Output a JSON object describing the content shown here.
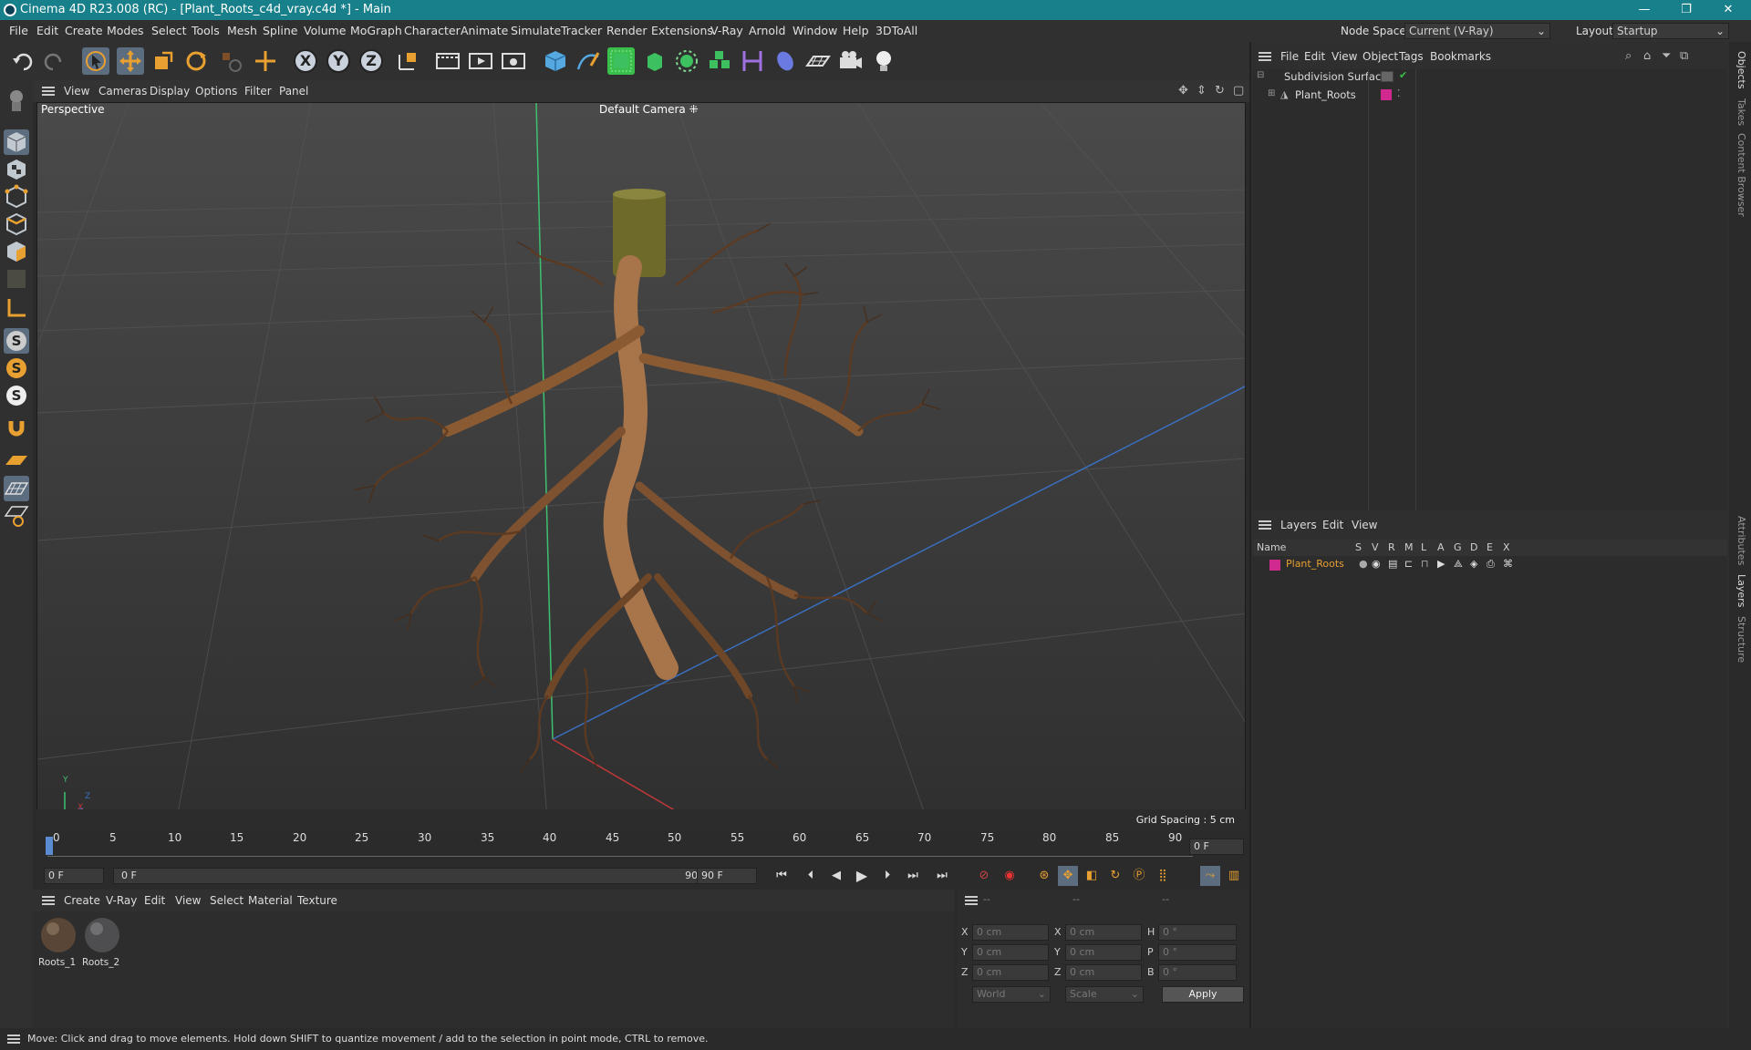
{
  "window": {
    "title": "Cinema 4D R23.008 (RC) - [Plant_Roots_c4d_vray.c4d *] - Main",
    "minimize": "—",
    "restore": "❐",
    "close": "✕"
  },
  "menu": {
    "items": [
      "File",
      "Edit",
      "Create",
      "Modes",
      "Select",
      "Tools",
      "Mesh",
      "Spline",
      "Volume",
      "MoGraph",
      "Character",
      "Animate",
      "Simulate",
      "Tracker",
      "Render",
      "Extensions",
      "V-Ray",
      "Arnold",
      "Window",
      "Help",
      "3DToAll"
    ],
    "node_space_label": "Node Space:",
    "node_space_value": "Current (V-Ray)",
    "layout_label": "Layout:",
    "layout_value": "Startup"
  },
  "viewport": {
    "menu": [
      "View",
      "Cameras",
      "Display",
      "Options",
      "Filter",
      "Panel"
    ],
    "name": "Perspective",
    "camera": "Default Camera",
    "grid_spacing": "Grid Spacing : 5 cm",
    "axis_labels": {
      "y": "Y",
      "z": "Z",
      "x": "X"
    }
  },
  "timeline": {
    "ticks": [
      "0",
      "5",
      "10",
      "15",
      "20",
      "25",
      "30",
      "35",
      "40",
      "45",
      "50",
      "55",
      "60",
      "65",
      "70",
      "75",
      "80",
      "85",
      "90"
    ],
    "current_frame": "0 F",
    "start_field": "0 F",
    "range_start": "0 F",
    "range_end": "90 F",
    "end_field": "90 F"
  },
  "materials": {
    "menu": [
      "Create",
      "V-Ray",
      "Edit",
      "View",
      "Select",
      "Material",
      "Texture"
    ],
    "items": [
      {
        "name": "Roots_1"
      },
      {
        "name": "Roots_2"
      }
    ]
  },
  "coords": {
    "headers": [
      "--",
      "--",
      "--"
    ],
    "rows": [
      {
        "a": "X",
        "av": "0 cm",
        "b": "X",
        "bv": "0 cm",
        "c": "H",
        "cv": "0 °"
      },
      {
        "a": "Y",
        "av": "0 cm",
        "b": "Y",
        "bv": "0 cm",
        "c": "P",
        "cv": "0 °"
      },
      {
        "a": "Z",
        "av": "0 cm",
        "b": "Z",
        "bv": "0 cm",
        "c": "B",
        "cv": "0 °"
      }
    ],
    "world": "World",
    "scale": "Scale",
    "apply": "Apply"
  },
  "objects": {
    "menu": [
      "File",
      "Edit",
      "View",
      "Object",
      "Tags",
      "Bookmarks"
    ],
    "tree": [
      {
        "name": "Subdivision Surface",
        "color": "#39c04a"
      },
      {
        "name": "Plant_Roots",
        "color": "#d02a8f"
      }
    ]
  },
  "layers": {
    "menu": [
      "Layers",
      "Edit",
      "View"
    ],
    "columns": [
      "Name",
      "S",
      "V",
      "R",
      "M",
      "L",
      "A",
      "G",
      "D",
      "E",
      "X"
    ],
    "rows": [
      {
        "name": "Plant_Roots",
        "color": "#d02a8f"
      }
    ]
  },
  "side_tabs": [
    "Objects",
    "Takes",
    "Content Browser",
    "Attributes",
    "Layers",
    "Structure"
  ],
  "status": "Move: Click and drag to move elements. Hold down SHIFT to quantize movement / add to the selection in point mode, CTRL to remove."
}
